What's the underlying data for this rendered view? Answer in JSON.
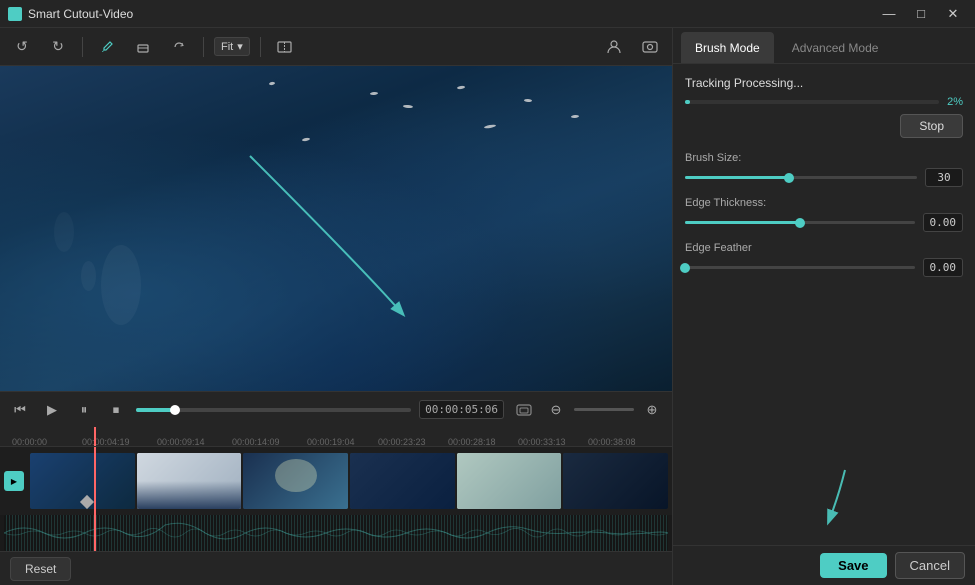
{
  "titleBar": {
    "title": "Smart Cutout-Video",
    "controls": {
      "minimize": "—",
      "maximize": "□",
      "close": "✕"
    }
  },
  "toolbar": {
    "undo_label": "↺",
    "redo_label": "↻",
    "brush_label": "✏",
    "eraser_label": "◻",
    "reset_label": "↺",
    "fit_label": "Fit",
    "chevron": "▾",
    "compare_label": "⧉",
    "avatar_label": "👤",
    "screen_label": "⬡"
  },
  "videoArea": {
    "no_content": ""
  },
  "timelineControls": {
    "skip_back": "⏮",
    "play": "▶",
    "pause": "⏸",
    "stop": "⏹",
    "time": "00:00:05:06",
    "minus": "⊖",
    "plus": "⊕"
  },
  "timeline": {
    "ruler_marks": [
      "00:00:00",
      "00:00:04:19",
      "00:00:09:14",
      "00:00:14:09",
      "00:00:19:04",
      "00:00:23:23",
      "00:00:28:18",
      "00:00:33:13",
      "00:00:38:08"
    ]
  },
  "rightPanel": {
    "mode_tabs": [
      {
        "label": "Brush Mode",
        "active": true
      },
      {
        "label": "Advanced Mode",
        "active": false
      }
    ],
    "tracking": {
      "title": "Tracking Processing...",
      "percent": "2%",
      "progress": 2,
      "stop_label": "Stop"
    },
    "brushSize": {
      "label": "Brush Size:",
      "value": "30",
      "percent": 45
    },
    "edgeThickness": {
      "label": "Edge Thickness:",
      "value": "0.00",
      "percent": 50
    },
    "edgeFeather": {
      "label": "Edge Feather",
      "value": "0.00",
      "percent": 0
    }
  },
  "bottomBar": {
    "reset_label": "Reset",
    "save_label": "Save",
    "cancel_label": "Cancel"
  }
}
